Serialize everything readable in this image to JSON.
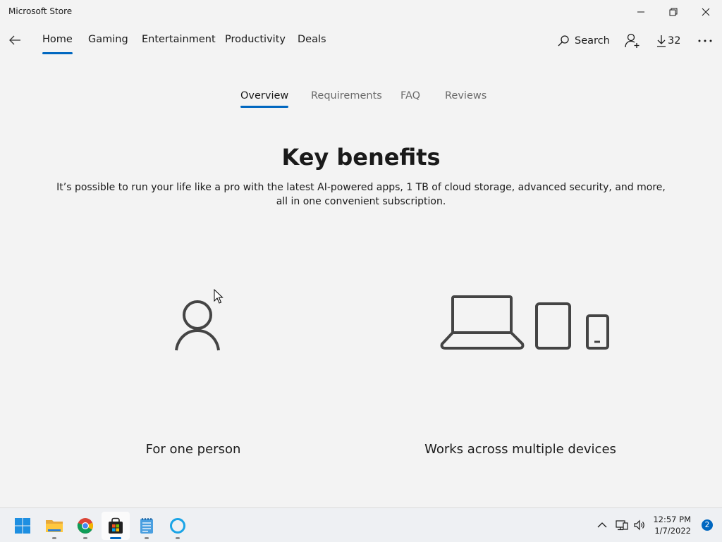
{
  "window": {
    "title": "Microsoft Store"
  },
  "nav": {
    "items": [
      {
        "label": "Home",
        "active": true
      },
      {
        "label": "Gaming"
      },
      {
        "label": "Entertainment"
      },
      {
        "label": "Productivity"
      },
      {
        "label": "Deals"
      }
    ],
    "search_label": "Search",
    "downloads_count": "32"
  },
  "tabs": [
    {
      "label": "Overview",
      "active": true
    },
    {
      "label": "Requirements"
    },
    {
      "label": "FAQ"
    },
    {
      "label": "Reviews"
    }
  ],
  "main": {
    "heading": "Key benefits",
    "description": "It’s possible to run your life like a pro with the latest AI-powered apps, 1 TB of cloud storage, advanced security, and more, all in one convenient subscription.",
    "benefits": [
      {
        "label": "For one person",
        "icon": "person-icon"
      },
      {
        "label": "Works across multiple devices",
        "icon": "devices-icon"
      }
    ]
  },
  "taskbar": {
    "apps": [
      "start",
      "file-explorer",
      "chrome",
      "microsoft-store",
      "notepad",
      "cortana"
    ],
    "active_app": "microsoft-store",
    "time": "12:57 PM",
    "date": "1/7/2022",
    "notification_count": "2"
  },
  "colors": {
    "accent": "#0067c0",
    "background": "#f3f3f3",
    "muted_text": "#6b6b6b"
  }
}
